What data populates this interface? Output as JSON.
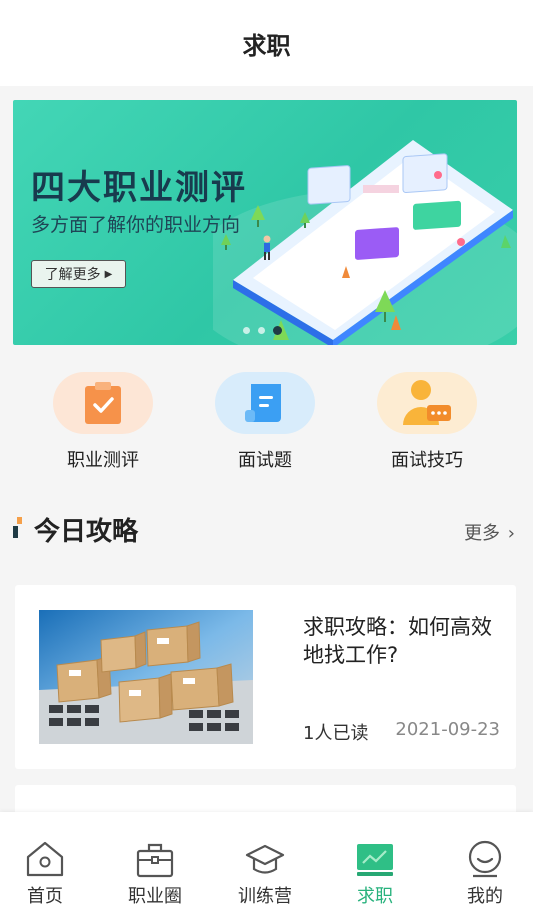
{
  "header": {
    "title": "求职"
  },
  "banner": {
    "headline": "四大职业测评",
    "subline": "多方面了解你的职业方向",
    "button_label": "了解更多",
    "slide_count": 3,
    "active_slide": 3
  },
  "shortcuts": [
    {
      "label": "职业测评",
      "icon": "clipboard-check-icon"
    },
    {
      "label": "面试题",
      "icon": "document-icon"
    },
    {
      "label": "面试技巧",
      "icon": "person-chat-icon"
    }
  ],
  "section": {
    "title": "今日攻略",
    "more_label": "更多"
  },
  "articles": [
    {
      "title": "求职攻略：如何高效地找工作?",
      "reads": "1人已读",
      "date": "2021-09-23"
    }
  ],
  "tabbar": {
    "items": [
      {
        "label": "首页",
        "icon": "home-icon"
      },
      {
        "label": "职业圈",
        "icon": "briefcase-icon"
      },
      {
        "label": "训练营",
        "icon": "graduation-cap-icon"
      },
      {
        "label": "求职",
        "icon": "chart-screen-icon"
      },
      {
        "label": "我的",
        "icon": "profile-icon"
      }
    ],
    "active": "求职"
  },
  "colors": {
    "accent": "#28b27d",
    "banner": "#3dcfac",
    "section_mark_orange": "#f5a04a"
  }
}
